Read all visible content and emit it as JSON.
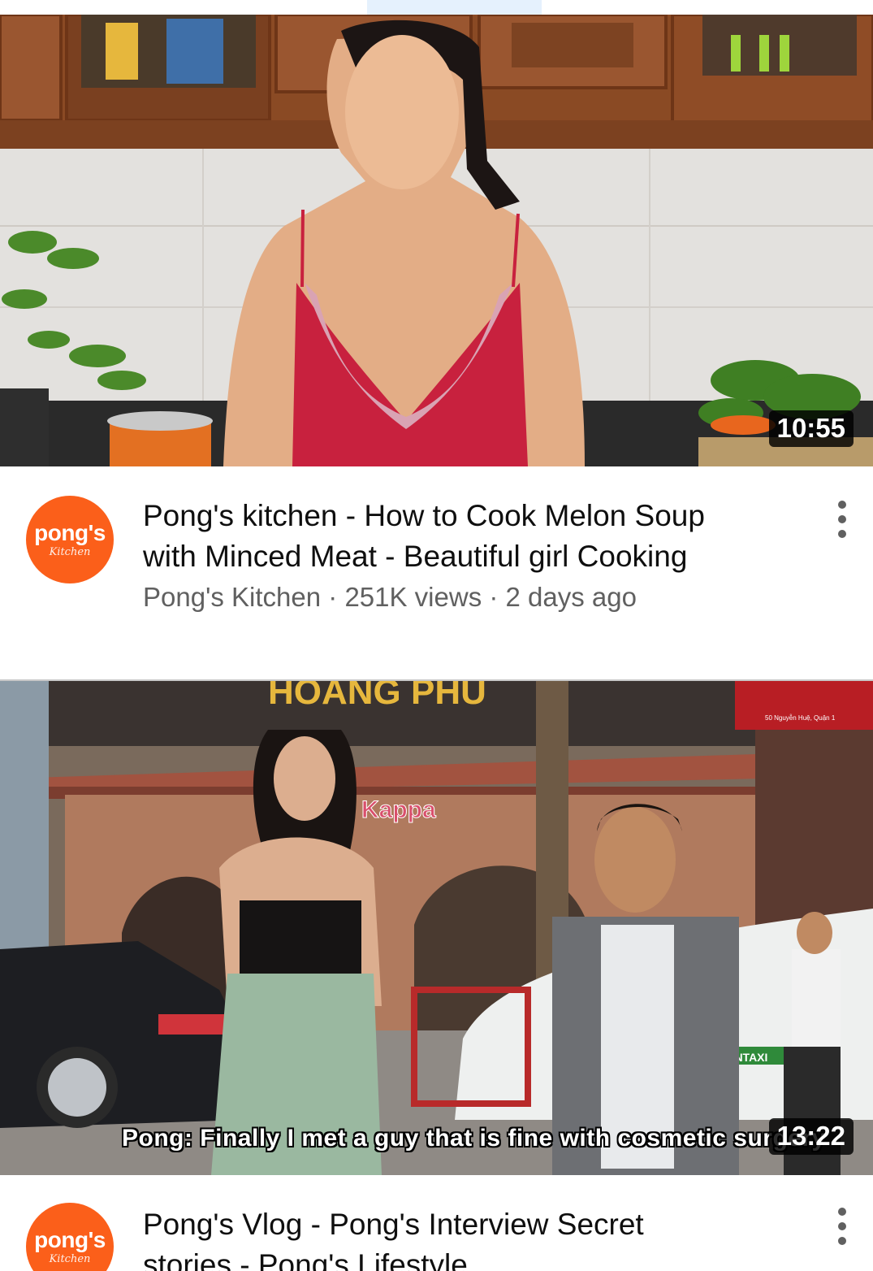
{
  "videos": [
    {
      "duration": "10:55",
      "title_line1": "Pong's kitchen - How to Cook Melon Soup",
      "title_line2": "with Minced Meat - Beautiful girl Cooking",
      "channel": "Pong's Kitchen",
      "views": "251K views",
      "age": "2 days ago",
      "avatar_text": "pong's",
      "avatar_script": "Kitchen",
      "thumbnail_text": ""
    },
    {
      "duration": "13:22",
      "title_line1": "Pong's Vlog - Pong's Interview Secret",
      "title_line2": "stories - Pong's Lifestyle",
      "avatar_text": "pong's",
      "avatar_script": "Kitchen",
      "caption": "Pong: Finally I met a guy that is fine with cosmetic surgery",
      "sign_hoang": "HOANG PHU",
      "sign_kappa": "Kappa",
      "sign_address": "50 Nguyễn Huệ, Quận 1",
      "sign_taxi": "SUNTAXI"
    }
  ],
  "separator": " · ",
  "colors": {
    "avatar": "#fb5f1a",
    "title": "#0f0f0f",
    "subtitle": "#606060"
  }
}
